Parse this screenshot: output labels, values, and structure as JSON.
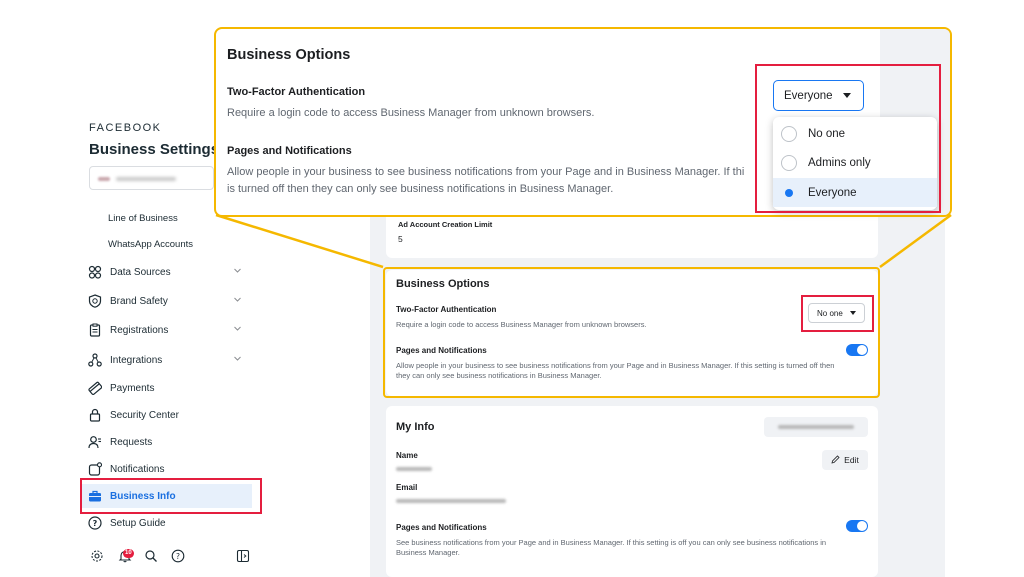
{
  "sidebar": {
    "brand": "FACEBOOK",
    "title": "Business Settings",
    "sub_items": [
      "Line of Business",
      "WhatsApp Accounts"
    ],
    "items": [
      {
        "label": "Data Sources",
        "icon": "data-sources-icon",
        "expandable": true
      },
      {
        "label": "Brand Safety",
        "icon": "shield-icon",
        "expandable": true
      },
      {
        "label": "Registrations",
        "icon": "clipboard-icon",
        "expandable": true
      },
      {
        "label": "Integrations",
        "icon": "integrations-icon",
        "expandable": true
      },
      {
        "label": "Payments",
        "icon": "payments-icon",
        "expandable": false
      },
      {
        "label": "Security Center",
        "icon": "lock-icon",
        "expandable": false
      },
      {
        "label": "Requests",
        "icon": "user-request-icon",
        "expandable": false
      },
      {
        "label": "Notifications",
        "icon": "notifications-icon",
        "expandable": false
      },
      {
        "label": "Business Info",
        "icon": "briefcase-icon",
        "expandable": false,
        "active": true
      },
      {
        "label": "Setup Guide",
        "icon": "help-icon",
        "expandable": false
      }
    ],
    "bottom": {
      "notification_badge": "10",
      "icons": [
        "settings-icon",
        "bell-icon",
        "search-icon",
        "help-icon",
        "panel-toggle-icon"
      ]
    }
  },
  "ad_account": {
    "label": "Ad Account Creation Limit",
    "value": "5"
  },
  "business_options": {
    "title": "Business Options",
    "two_factor": {
      "title": "Two-Factor Authentication",
      "description": "Require a login code to access Business Manager from unknown browsers.",
      "current_value": "No one"
    },
    "pages_notifications": {
      "title": "Pages and Notifications",
      "description": "Allow people in your business to see business notifications from your Page and in Business Manager. If this setting is turned off then they can only see business notifications in Business Manager.",
      "enabled": true
    }
  },
  "zoom_callout": {
    "title": "Business Options",
    "two_factor_title": "Two-Factor Authentication",
    "two_factor_desc": "Require a login code to access Business Manager from unknown browsers.",
    "pages_title": "Pages and Notifications",
    "pages_desc_line1": "Allow people in your business to see business notifications from your Page and in Business Manager. If thi",
    "pages_desc_line2": "is turned off then they can only see business notifications in Business Manager.",
    "dropdown_value": "Everyone",
    "options": [
      {
        "label": "No one",
        "selected": false
      },
      {
        "label": "Admins only",
        "selected": false
      },
      {
        "label": "Everyone",
        "selected": true
      }
    ]
  },
  "my_info": {
    "title": "My Info",
    "name_label": "Name",
    "email_label": "Email",
    "edit_label": "Edit",
    "pages_title": "Pages and Notifications",
    "pages_desc": "See business notifications from your Page and in Business Manager. If this setting is off you can only see business notifications in Business Manager.",
    "enabled": true
  },
  "colors": {
    "accent": "#1877f2",
    "highlight_red": "#e41e3f",
    "highlight_yellow": "#f5b800"
  }
}
